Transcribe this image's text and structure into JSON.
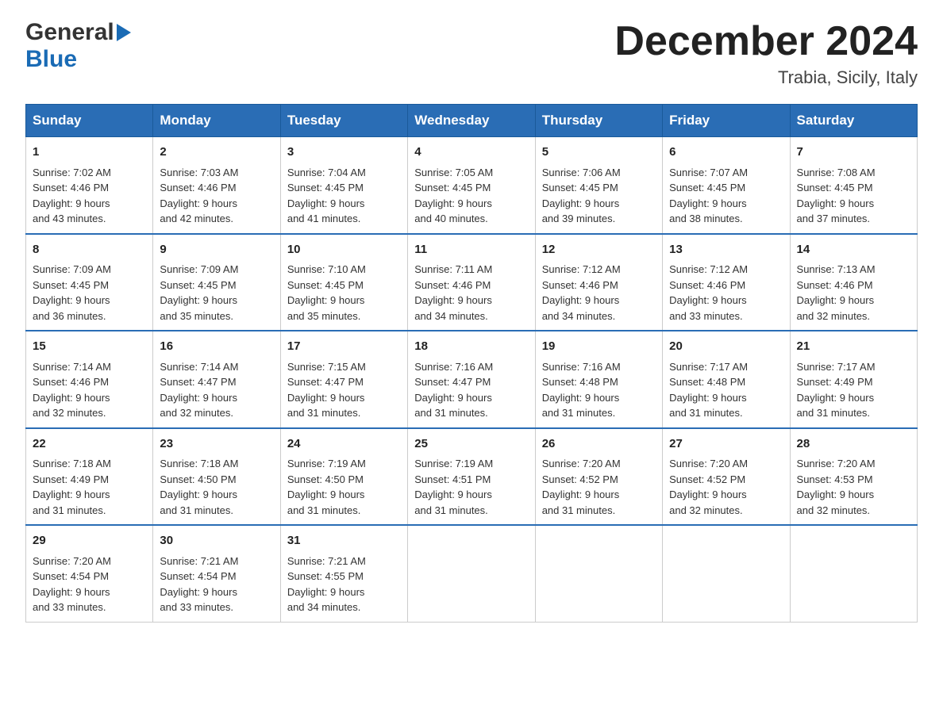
{
  "header": {
    "logo": {
      "general": "General",
      "arrow": "▶",
      "blue": "Blue"
    },
    "title": "December 2024",
    "location": "Trabia, Sicily, Italy"
  },
  "days_of_week": [
    "Sunday",
    "Monday",
    "Tuesday",
    "Wednesday",
    "Thursday",
    "Friday",
    "Saturday"
  ],
  "weeks": [
    [
      {
        "day": "1",
        "sunrise": "Sunrise: 7:02 AM",
        "sunset": "Sunset: 4:46 PM",
        "daylight": "Daylight: 9 hours",
        "minutes": "and 43 minutes."
      },
      {
        "day": "2",
        "sunrise": "Sunrise: 7:03 AM",
        "sunset": "Sunset: 4:46 PM",
        "daylight": "Daylight: 9 hours",
        "minutes": "and 42 minutes."
      },
      {
        "day": "3",
        "sunrise": "Sunrise: 7:04 AM",
        "sunset": "Sunset: 4:45 PM",
        "daylight": "Daylight: 9 hours",
        "minutes": "and 41 minutes."
      },
      {
        "day": "4",
        "sunrise": "Sunrise: 7:05 AM",
        "sunset": "Sunset: 4:45 PM",
        "daylight": "Daylight: 9 hours",
        "minutes": "and 40 minutes."
      },
      {
        "day": "5",
        "sunrise": "Sunrise: 7:06 AM",
        "sunset": "Sunset: 4:45 PM",
        "daylight": "Daylight: 9 hours",
        "minutes": "and 39 minutes."
      },
      {
        "day": "6",
        "sunrise": "Sunrise: 7:07 AM",
        "sunset": "Sunset: 4:45 PM",
        "daylight": "Daylight: 9 hours",
        "minutes": "and 38 minutes."
      },
      {
        "day": "7",
        "sunrise": "Sunrise: 7:08 AM",
        "sunset": "Sunset: 4:45 PM",
        "daylight": "Daylight: 9 hours",
        "minutes": "and 37 minutes."
      }
    ],
    [
      {
        "day": "8",
        "sunrise": "Sunrise: 7:09 AM",
        "sunset": "Sunset: 4:45 PM",
        "daylight": "Daylight: 9 hours",
        "minutes": "and 36 minutes."
      },
      {
        "day": "9",
        "sunrise": "Sunrise: 7:09 AM",
        "sunset": "Sunset: 4:45 PM",
        "daylight": "Daylight: 9 hours",
        "minutes": "and 35 minutes."
      },
      {
        "day": "10",
        "sunrise": "Sunrise: 7:10 AM",
        "sunset": "Sunset: 4:45 PM",
        "daylight": "Daylight: 9 hours",
        "minutes": "and 35 minutes."
      },
      {
        "day": "11",
        "sunrise": "Sunrise: 7:11 AM",
        "sunset": "Sunset: 4:46 PM",
        "daylight": "Daylight: 9 hours",
        "minutes": "and 34 minutes."
      },
      {
        "day": "12",
        "sunrise": "Sunrise: 7:12 AM",
        "sunset": "Sunset: 4:46 PM",
        "daylight": "Daylight: 9 hours",
        "minutes": "and 34 minutes."
      },
      {
        "day": "13",
        "sunrise": "Sunrise: 7:12 AM",
        "sunset": "Sunset: 4:46 PM",
        "daylight": "Daylight: 9 hours",
        "minutes": "and 33 minutes."
      },
      {
        "day": "14",
        "sunrise": "Sunrise: 7:13 AM",
        "sunset": "Sunset: 4:46 PM",
        "daylight": "Daylight: 9 hours",
        "minutes": "and 32 minutes."
      }
    ],
    [
      {
        "day": "15",
        "sunrise": "Sunrise: 7:14 AM",
        "sunset": "Sunset: 4:46 PM",
        "daylight": "Daylight: 9 hours",
        "minutes": "and 32 minutes."
      },
      {
        "day": "16",
        "sunrise": "Sunrise: 7:14 AM",
        "sunset": "Sunset: 4:47 PM",
        "daylight": "Daylight: 9 hours",
        "minutes": "and 32 minutes."
      },
      {
        "day": "17",
        "sunrise": "Sunrise: 7:15 AM",
        "sunset": "Sunset: 4:47 PM",
        "daylight": "Daylight: 9 hours",
        "minutes": "and 31 minutes."
      },
      {
        "day": "18",
        "sunrise": "Sunrise: 7:16 AM",
        "sunset": "Sunset: 4:47 PM",
        "daylight": "Daylight: 9 hours",
        "minutes": "and 31 minutes."
      },
      {
        "day": "19",
        "sunrise": "Sunrise: 7:16 AM",
        "sunset": "Sunset: 4:48 PM",
        "daylight": "Daylight: 9 hours",
        "minutes": "and 31 minutes."
      },
      {
        "day": "20",
        "sunrise": "Sunrise: 7:17 AM",
        "sunset": "Sunset: 4:48 PM",
        "daylight": "Daylight: 9 hours",
        "minutes": "and 31 minutes."
      },
      {
        "day": "21",
        "sunrise": "Sunrise: 7:17 AM",
        "sunset": "Sunset: 4:49 PM",
        "daylight": "Daylight: 9 hours",
        "minutes": "and 31 minutes."
      }
    ],
    [
      {
        "day": "22",
        "sunrise": "Sunrise: 7:18 AM",
        "sunset": "Sunset: 4:49 PM",
        "daylight": "Daylight: 9 hours",
        "minutes": "and 31 minutes."
      },
      {
        "day": "23",
        "sunrise": "Sunrise: 7:18 AM",
        "sunset": "Sunset: 4:50 PM",
        "daylight": "Daylight: 9 hours",
        "minutes": "and 31 minutes."
      },
      {
        "day": "24",
        "sunrise": "Sunrise: 7:19 AM",
        "sunset": "Sunset: 4:50 PM",
        "daylight": "Daylight: 9 hours",
        "minutes": "and 31 minutes."
      },
      {
        "day": "25",
        "sunrise": "Sunrise: 7:19 AM",
        "sunset": "Sunset: 4:51 PM",
        "daylight": "Daylight: 9 hours",
        "minutes": "and 31 minutes."
      },
      {
        "day": "26",
        "sunrise": "Sunrise: 7:20 AM",
        "sunset": "Sunset: 4:52 PM",
        "daylight": "Daylight: 9 hours",
        "minutes": "and 31 minutes."
      },
      {
        "day": "27",
        "sunrise": "Sunrise: 7:20 AM",
        "sunset": "Sunset: 4:52 PM",
        "daylight": "Daylight: 9 hours",
        "minutes": "and 32 minutes."
      },
      {
        "day": "28",
        "sunrise": "Sunrise: 7:20 AM",
        "sunset": "Sunset: 4:53 PM",
        "daylight": "Daylight: 9 hours",
        "minutes": "and 32 minutes."
      }
    ],
    [
      {
        "day": "29",
        "sunrise": "Sunrise: 7:20 AM",
        "sunset": "Sunset: 4:54 PM",
        "daylight": "Daylight: 9 hours",
        "minutes": "and 33 minutes."
      },
      {
        "day": "30",
        "sunrise": "Sunrise: 7:21 AM",
        "sunset": "Sunset: 4:54 PM",
        "daylight": "Daylight: 9 hours",
        "minutes": "and 33 minutes."
      },
      {
        "day": "31",
        "sunrise": "Sunrise: 7:21 AM",
        "sunset": "Sunset: 4:55 PM",
        "daylight": "Daylight: 9 hours",
        "minutes": "and 34 minutes."
      },
      null,
      null,
      null,
      null
    ]
  ]
}
